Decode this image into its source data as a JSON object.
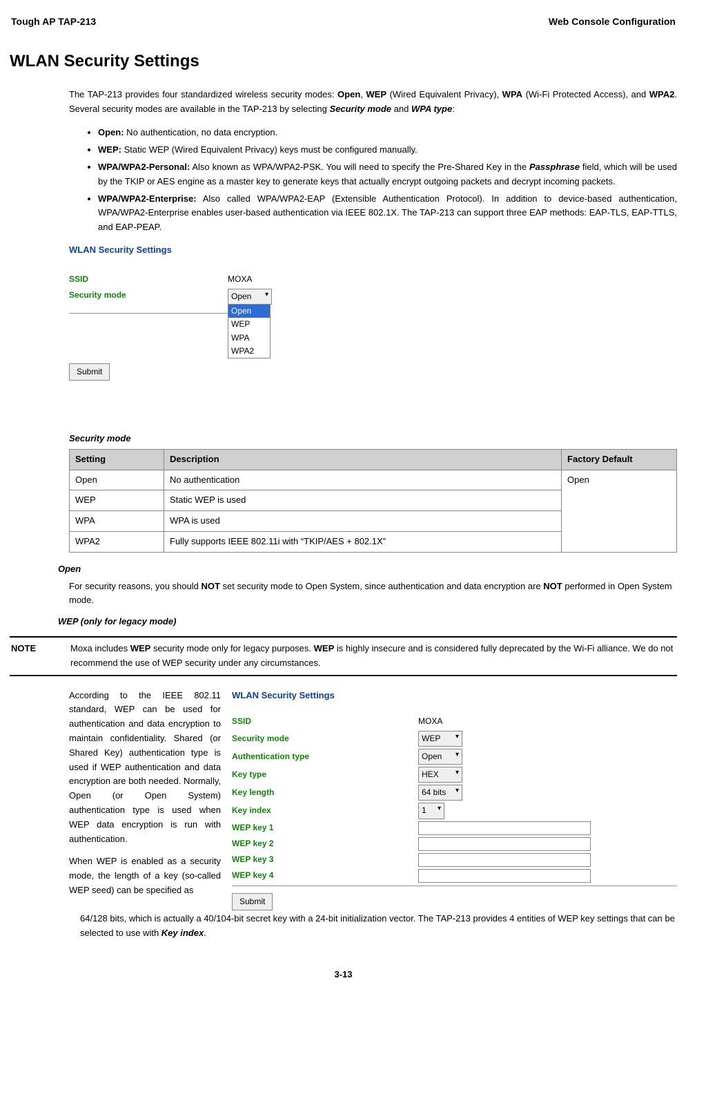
{
  "header": {
    "left": "Tough AP TAP-213",
    "right": "Web Console Configuration"
  },
  "title": "WLAN Security Settings",
  "intro_html": "The TAP-213 provides four standardized wireless security modes: <b>Open</b>, <b>WEP</b> (Wired Equivalent Privacy), <b>WPA</b> (Wi-Fi Protected Access), and <b>WPA2</b>. Several security modes are available in the TAP-213 by selecting <b><i>Security mode</i></b> and <b><i>WPA type</i></b>:",
  "bullets": [
    "<b>Open:</b> No authentication, no data encryption.",
    "<b>WEP:</b> Static WEP (Wired Equivalent Privacy) keys must be configured manually.",
    "<b>WPA/WPA2-Personal:</b> Also known as WPA/WPA2-PSK. You will need to specify the Pre-Shared Key in the <b><i>Passphrase</i></b> field, which will be used by the TKIP or AES engine as a master key to generate keys that actually encrypt outgoing packets and decrypt incoming packets.",
    "<b>WPA/WPA2-Enterprise:</b> Also called WPA/WPA2-EAP (Extensible Authentication Protocol). In addition to device-based authentication, WPA/WPA2-Enterprise enables user-based authentication via IEEE 802.1X. The TAP-213 can support three EAP methods: EAP-TLS, EAP-TTLS, and EAP-PEAP."
  ],
  "screenshot1": {
    "title": "WLAN Security Settings",
    "ssid_label": "SSID",
    "ssid_value": "MOXA",
    "secmode_label": "Security mode",
    "secmode_selected": "Open",
    "dropdown": [
      "Open",
      "WEP",
      "WPA",
      "WPA2"
    ],
    "submit": "Submit"
  },
  "table_heading": "Security mode",
  "table": {
    "headers": [
      "Setting",
      "Description",
      "Factory Default"
    ],
    "rows": [
      [
        "Open",
        "No authentication"
      ],
      [
        "WEP",
        "Static WEP is used"
      ],
      [
        "WPA",
        "WPA is used"
      ],
      [
        "WPA2",
        "Fully supports IEEE 802.11i with “TKIP/AES + 802.1X”"
      ]
    ],
    "default": "Open"
  },
  "open_heading": "Open",
  "open_text_html": "For security reasons, you should <b>NOT</b> set security mode to Open System, since authentication and data encryption are <b>NOT</b> performed in Open System mode.",
  "wep_heading": "WEP (only for legacy mode)",
  "note": {
    "label": "NOTE",
    "text_html": "Moxa includes <b>WEP</b> security mode only for legacy purposes. <b>WEP</b> is highly insecure and is considered fully deprecated by the Wi-Fi alliance. We do not recommend the use of WEP security under any circumstances."
  },
  "wep_paragraphs": [
    "According to the IEEE 802.11 standard, WEP can be used for authentication and data encryption to maintain confidentiality. Shared (or Shared Key) authentication type is used if WEP authentication and data encryption are both needed. Normally, Open (or Open System) authentication type is used when WEP data encryption is run with authentication.",
    "When WEP is enabled as a security mode, the length of a key (so-called WEP seed) can be specified as"
  ],
  "wep_continuation_html": "64/128 bits, which is actually a 40/104-bit secret key with a 24-bit initialization vector. The TAP-213 provides 4 entities of WEP key settings that can be selected to use with <b><i>Key index</i></b>.",
  "screenshot2": {
    "title": "WLAN Security Settings",
    "rows": [
      {
        "label": "SSID",
        "type": "text",
        "value": "MOXA"
      },
      {
        "label": "Security mode",
        "type": "select",
        "value": "WEP"
      },
      {
        "label": "Authentication type",
        "type": "select",
        "value": "Open"
      },
      {
        "label": "Key type",
        "type": "select",
        "value": "HEX"
      },
      {
        "label": "Key length",
        "type": "select",
        "value": "64 bits"
      },
      {
        "label": "Key index",
        "type": "select",
        "value": "1"
      },
      {
        "label": "WEP key 1",
        "type": "input",
        "value": ""
      },
      {
        "label": "WEP key 2",
        "type": "input",
        "value": ""
      },
      {
        "label": "WEP key 3",
        "type": "input",
        "value": ""
      },
      {
        "label": "WEP key 4",
        "type": "input",
        "value": ""
      }
    ],
    "submit": "Submit"
  },
  "page_number": "3-13"
}
